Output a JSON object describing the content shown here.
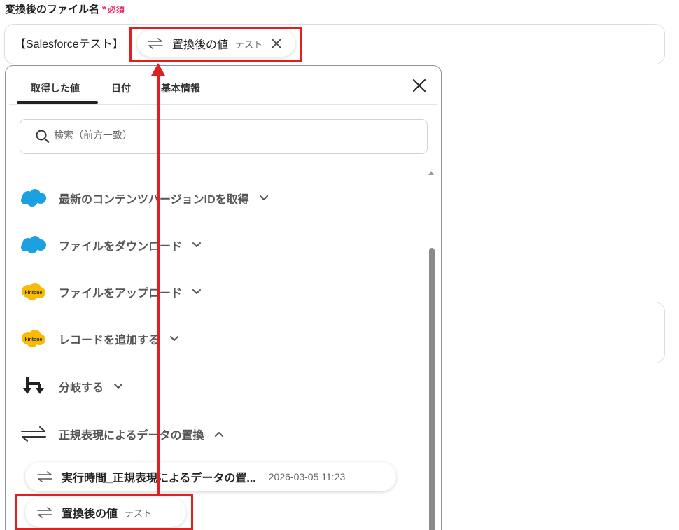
{
  "field": {
    "label": "変換後のファイル名",
    "required_star": "*",
    "required_text": "必須",
    "prefix": "【Salesforceテスト】",
    "chip": {
      "name": "置換後の値",
      "value": "テスト",
      "icon": "swap-arrows-icon"
    }
  },
  "popup": {
    "tabs": [
      "取得した値",
      "日付",
      "基本情報"
    ],
    "active_tab": "取得した値",
    "search_placeholder": "検索（前方一致）",
    "steps": [
      {
        "label": "最新のコンテンツバージョンIDを取得",
        "icon": "salesforce-cloud-icon",
        "expanded": false
      },
      {
        "label": "ファイルをダウンロード",
        "icon": "salesforce-cloud-icon",
        "expanded": false
      },
      {
        "label": "ファイルをアップロード",
        "icon": "kintone-icon",
        "expanded": false
      },
      {
        "label": "レコードを追加する",
        "icon": "kintone-icon",
        "expanded": false
      },
      {
        "label": "分岐する",
        "icon": "branch-icon",
        "expanded": false
      },
      {
        "label": "正規表現によるデータの置換",
        "icon": "swap-arrows-icon",
        "expanded": true
      }
    ],
    "outputs": [
      {
        "name": "実行時間_正規表現によるデータの置...",
        "value": "2026-03-05 11:23"
      },
      {
        "name": "置換後の値",
        "value": "テスト"
      }
    ]
  },
  "kintone_logo_text": "kintone",
  "colors": {
    "required": "#e5326d",
    "highlight": "#e02020",
    "salesforce": "#1ba0e1",
    "kintone": "#fbb900"
  }
}
